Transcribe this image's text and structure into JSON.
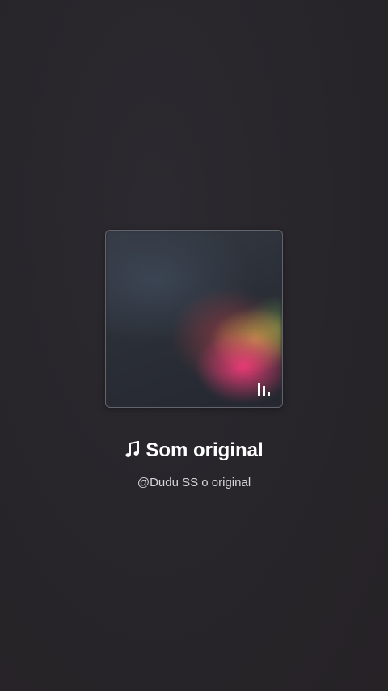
{
  "sound": {
    "title": "Som original",
    "author": "@Dudu SS o original",
    "icon": "music-note-icon"
  },
  "cover": {
    "badge_icon": "audio-bars-icon"
  },
  "colors": {
    "background": "#28262b",
    "title_text": "#ffffff",
    "subtitle_text": "#d6d4d8"
  }
}
